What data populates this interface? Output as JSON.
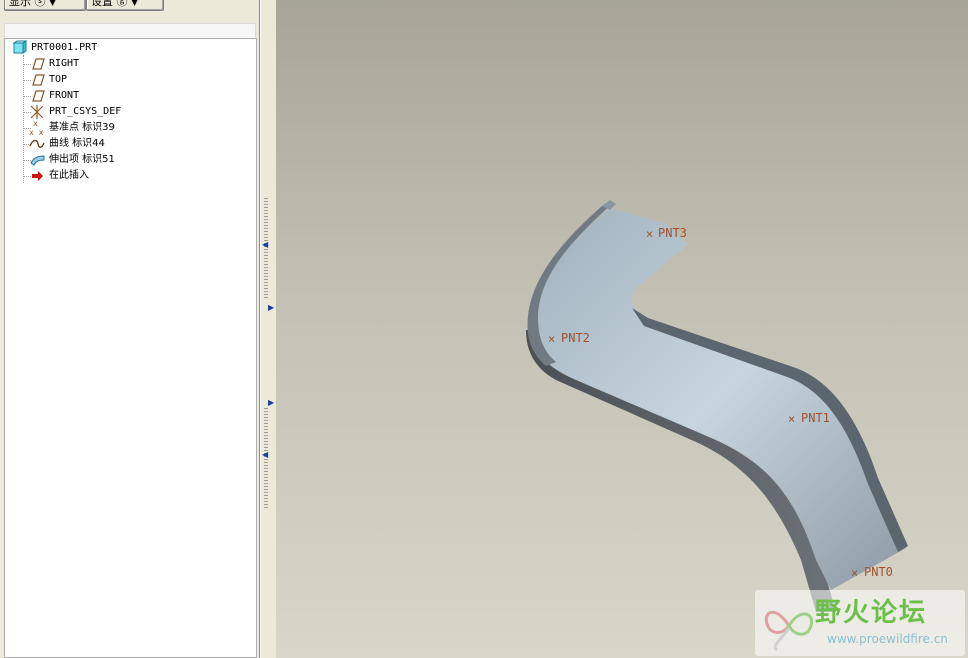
{
  "toolbar": {
    "show_label": "显示 ⓢ",
    "settings_label": "设置 ⓖ"
  },
  "model_tree": {
    "root": "PRT0001.PRT",
    "items": [
      {
        "label": "RIGHT",
        "icon": "datum-plane-icon"
      },
      {
        "label": "TOP",
        "icon": "datum-plane-icon"
      },
      {
        "label": "FRONT",
        "icon": "datum-plane-icon"
      },
      {
        "label": "PRT_CSYS_DEF",
        "icon": "coordinate-system-icon"
      },
      {
        "label": "基准点 标识39",
        "icon": "datum-point-icon"
      },
      {
        "label": "曲线 标识44",
        "icon": "curve-icon"
      },
      {
        "label": "伸出项 标识51",
        "icon": "protrusion-icon"
      },
      {
        "label": "在此插入",
        "icon": "insert-here-arrow-icon"
      }
    ]
  },
  "viewport": {
    "points": [
      "PNT0",
      "PNT1",
      "PNT2",
      "PNT3"
    ]
  },
  "watermark": {
    "title": "野火论坛",
    "url": "www.proewildfire.cn"
  },
  "colors": {
    "model_top": "#aab8c4",
    "model_side": "#5a6066",
    "point_label": "#a0522d",
    "watermark_green": "#6cc04a"
  }
}
